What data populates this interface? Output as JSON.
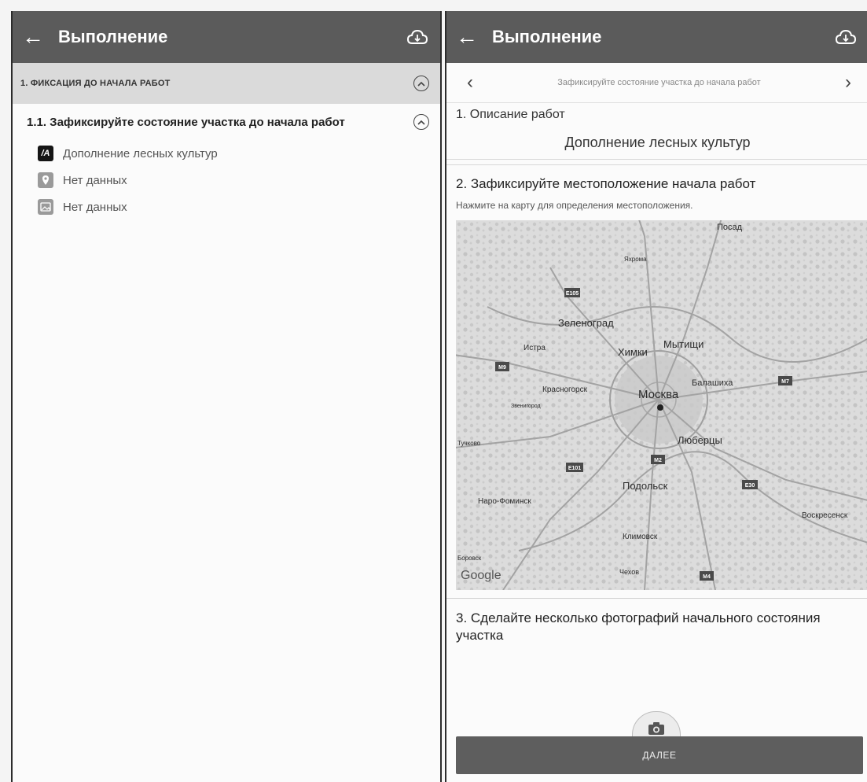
{
  "left": {
    "appbar": {
      "title": "Выполнение",
      "back_icon": "arrow-left-icon",
      "action_icon": "cloud-sync-icon"
    },
    "section": {
      "title": "1. ФИКСАЦИЯ ДО НАЧАЛА РАБОТ"
    },
    "subsection": {
      "title": "1.1. Зафиксируйте состояние участка до начала работ"
    },
    "items": [
      {
        "icon": "text-icon",
        "icon_text": "/A",
        "label": "Дополнение лесных культур"
      },
      {
        "icon": "location-icon",
        "label": "Нет данных"
      },
      {
        "icon": "photo-icon",
        "label": "Нет данных"
      }
    ]
  },
  "right": {
    "appbar": {
      "title": "Выполнение",
      "back_icon": "arrow-left-icon",
      "action_icon": "cloud-sync-icon"
    },
    "stepper": {
      "prev": "‹",
      "title": "Зафиксируйте состояние участка до начала работ",
      "next": "›"
    },
    "block1": {
      "heading": "1. Описание работ",
      "value": "Дополнение лесных культур"
    },
    "block2": {
      "heading": "2. Зафиксируйте местоположение начала работ",
      "hint": "Нажмите на карту для определения местоположения."
    },
    "map": {
      "logo": "Google",
      "places": [
        "Яхрома",
        "Зеленоград",
        "Истра",
        "Химки",
        "Мытищи",
        "Красногорск",
        "Москва",
        "Балашиха",
        "Звенигород",
        "Тучково",
        "Люберцы",
        "Подольск",
        "Наро-Фоминск",
        "Климовск",
        "Воскресенск",
        "Боровск",
        "Чехов",
        "Посад"
      ],
      "road_badges": [
        "E105",
        "M9",
        "M7",
        "E101",
        "M2",
        "E30",
        "M4"
      ]
    },
    "block3": {
      "heading": "3. Сделайте несколько фотографий начального состояния участка"
    },
    "camera_icon": "camera-icon",
    "next_button": "ДАЛЕЕ"
  },
  "colors": {
    "appbar": "#5b5b5b",
    "section_bar": "#dadada",
    "next_button": "#5e5e5e"
  }
}
